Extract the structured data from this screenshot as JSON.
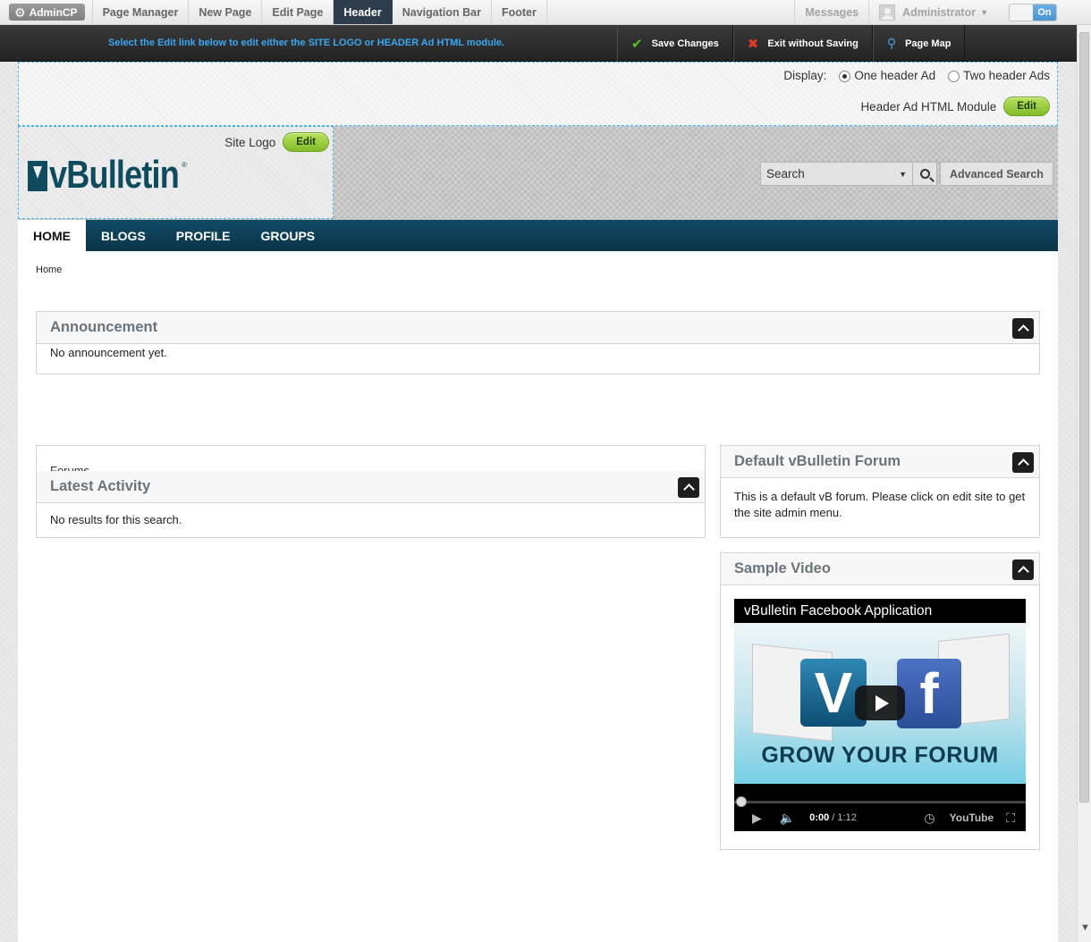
{
  "adminbar": {
    "admincp_label": "AdminCP",
    "nav": [
      "Page Manager",
      "New Page",
      "Edit Page",
      "Header",
      "Navigation Bar",
      "Footer"
    ],
    "active_nav": "Header",
    "messages_label": "Messages",
    "user_label": "Administrator",
    "toggle_label": "On"
  },
  "editbar": {
    "instruction": "Select the Edit link below to edit either the SITE LOGO or HEADER Ad HTML module.",
    "save_label": "Save Changes",
    "exit_label": "Exit without Saving",
    "pagemap_label": "Page Map"
  },
  "header_ad": {
    "display_label": "Display:",
    "option_one": "One header Ad",
    "option_two": "Two header Ads",
    "selected_option": "One header Ad",
    "module_label": "Header Ad HTML Module",
    "edit_label": "Edit"
  },
  "site_logo": {
    "label": "Site Logo",
    "edit_label": "Edit",
    "logo_text": "vBulletin",
    "registered_mark": "®"
  },
  "search": {
    "placeholder": "Search",
    "advanced_label": "Advanced Search"
  },
  "mainnav": {
    "items": [
      "HOME",
      "BLOGS",
      "PROFILE",
      "GROUPS"
    ],
    "active": "HOME"
  },
  "breadcrumb": "Home",
  "widgets": {
    "announcement": {
      "title": "Announcement",
      "body": "No announcement yet."
    },
    "forums_tab": "Forums",
    "latest_activity": {
      "title": "Latest Activity",
      "body": "No results for this search."
    },
    "default_forum": {
      "title": "Default vBulletin Forum",
      "body": "This is a default vB forum. Please click on edit site to get the site admin menu."
    },
    "sample_video": {
      "title": "Sample Video",
      "video_title": "vBulletin Facebook Application",
      "overlay_text": "GROW YOUR FORUM",
      "current_time": "0:00",
      "separator": " / ",
      "duration": "1:12",
      "youtube_label": "YouTube"
    }
  },
  "colors": {
    "nav_bg": "#0d3f58",
    "accent_blue": "#3aa6f0",
    "edit_green": "#9acd3c",
    "save_check": "#5ec22a",
    "exit_x": "#e23b2e"
  }
}
